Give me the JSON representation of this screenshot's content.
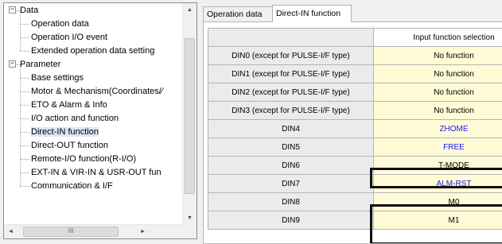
{
  "tree": {
    "items": [
      {
        "label": "Data",
        "level": 0,
        "toggle": "−"
      },
      {
        "label": "Operation data",
        "level": 1
      },
      {
        "label": "Operation I/O event",
        "level": 1
      },
      {
        "label": "Extended operation data setting",
        "level": 1
      },
      {
        "label": "Parameter",
        "level": 0,
        "toggle": "−"
      },
      {
        "label": "Base settings",
        "level": 1
      },
      {
        "label": "Motor & Mechanism(Coordinates/⁄",
        "level": 1
      },
      {
        "label": "ETO & Alarm & Info",
        "level": 1
      },
      {
        "label": "I/O action and function",
        "level": 1
      },
      {
        "label": "Direct-IN function",
        "level": 1,
        "selected": true
      },
      {
        "label": "Direct-OUT function",
        "level": 1
      },
      {
        "label": "Remote-I/O function(R-I/O)",
        "level": 1
      },
      {
        "label": "EXT-IN & VIR-IN & USR-OUT fun",
        "level": 1
      },
      {
        "label": "Communication & I/F",
        "level": 1
      }
    ],
    "scroll_up_icon": "▲",
    "scroll_down_icon": "▼",
    "scroll_left_icon": "◄",
    "scroll_right_icon": "►",
    "hthumb_grip": "III",
    "vthumb_grip": "≡"
  },
  "tabs": [
    {
      "label": "Operation data",
      "active": false
    },
    {
      "label": "Direct-IN function",
      "active": true
    }
  ],
  "grid": {
    "column_header": "Input function selection",
    "rows": [
      {
        "name": "DIN0 (except for PULSE-I/F type)",
        "value": "No function",
        "blue": false
      },
      {
        "name": "DIN1 (except for PULSE-I/F type)",
        "value": "No function",
        "blue": false
      },
      {
        "name": "DIN2 (except for PULSE-I/F type)",
        "value": "No function",
        "blue": false
      },
      {
        "name": "DIN3 (except for PULSE-I/F type)",
        "value": "No function",
        "blue": false
      },
      {
        "name": "DIN4",
        "value": "ZHOME",
        "blue": true
      },
      {
        "name": "DIN5",
        "value": "FREE",
        "blue": true
      },
      {
        "name": "DIN6",
        "value": "T-MODE",
        "blue": false
      },
      {
        "name": "DIN7",
        "value": "ALM-RST",
        "blue": true
      },
      {
        "name": "DIN8",
        "value": "M0",
        "blue": false
      },
      {
        "name": "DIN9",
        "value": "M1",
        "blue": false
      }
    ]
  },
  "colors": {
    "value_cell_bg": "#fffbd6",
    "header_cell_bg": "#ebebeb",
    "blue_text": "#1a1aee",
    "selection_box": "#101010"
  }
}
